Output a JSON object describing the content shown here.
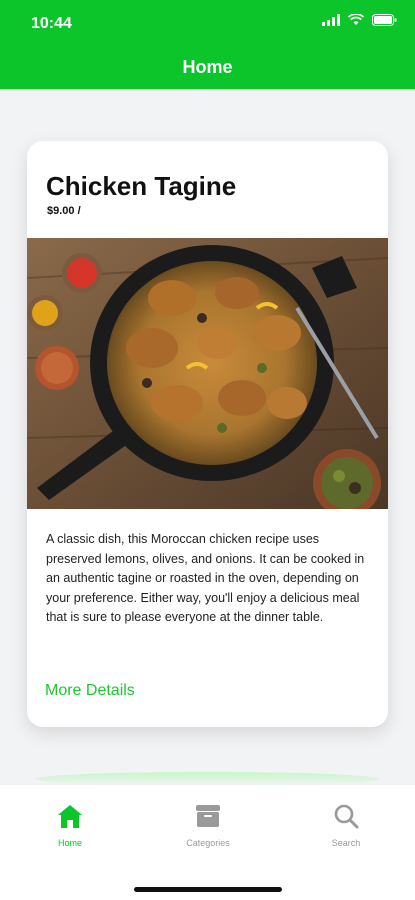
{
  "status_bar": {
    "time": "10:44"
  },
  "nav": {
    "title": "Home"
  },
  "product": {
    "title": "Chicken Tagine",
    "price": "$9.00 /",
    "description": "A classic dish, this Moroccan chicken recipe uses preserved lemons, olives, and onions. It can be cooked in an authentic tagine or roasted in the oven, depending on your preference. Either way, you'll enjoy a delicious meal that is sure to please everyone at the dinner table.",
    "more_label": "More Details"
  },
  "tabs": [
    {
      "label": "Home",
      "icon": "home-icon",
      "active": true
    },
    {
      "label": "Categories",
      "icon": "categories-icon",
      "active": false
    },
    {
      "label": "Search",
      "icon": "search-icon",
      "active": false
    }
  ],
  "colors": {
    "accent": "#0bc52b",
    "link": "#22c436",
    "inactive": "#9a9a9a"
  }
}
